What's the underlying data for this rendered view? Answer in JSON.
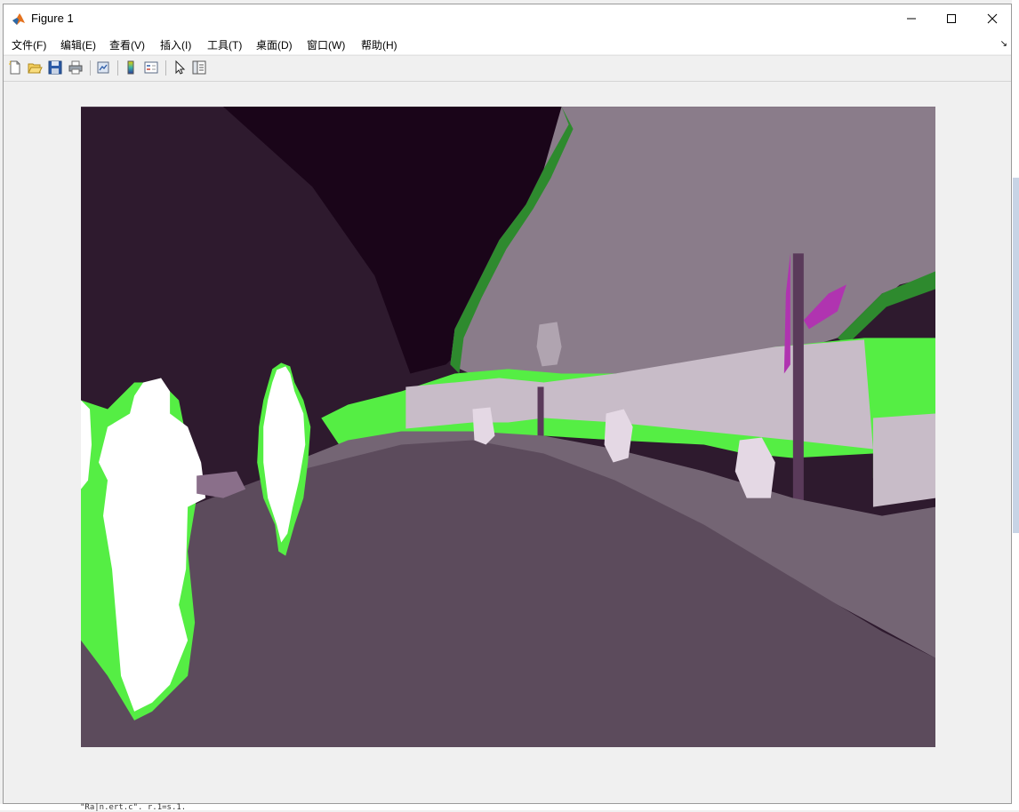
{
  "window": {
    "title": "Figure 1",
    "controls": {
      "minimize": "minimize-icon",
      "maximize": "maximize-icon",
      "close": "close-icon"
    }
  },
  "menubar": {
    "items": [
      {
        "label": "文件(F)"
      },
      {
        "label": "编辑(E)"
      },
      {
        "label": "查看(V)"
      },
      {
        "label": "插入(I)"
      },
      {
        "label": "工具(T)"
      },
      {
        "label": "桌面(D)"
      },
      {
        "label": "窗口(W)"
      },
      {
        "label": "帮助(H)"
      }
    ]
  },
  "toolbar": {
    "buttons": [
      "new-figure-icon",
      "open-file-icon",
      "save-icon",
      "print-icon",
      "link-plot-icon",
      "colorbar-icon",
      "legend-icon",
      "edit-plot-arrow-icon",
      "property-inspector-icon"
    ]
  },
  "figure": {
    "image_description_colors": {
      "sky": "#1a0519",
      "dark_foliage": "#2e1a2e",
      "trees_light": "#8a7c8a",
      "road": "#5c4b5c",
      "sidewalk": "#746574",
      "wall": "#c8bcc8",
      "people": "#ffffff",
      "green": "#55ee44",
      "magenta": "#b034b0"
    }
  },
  "background": {
    "bottom_text": "\"Ra|n.ert.c\".    r.1=s.1."
  }
}
